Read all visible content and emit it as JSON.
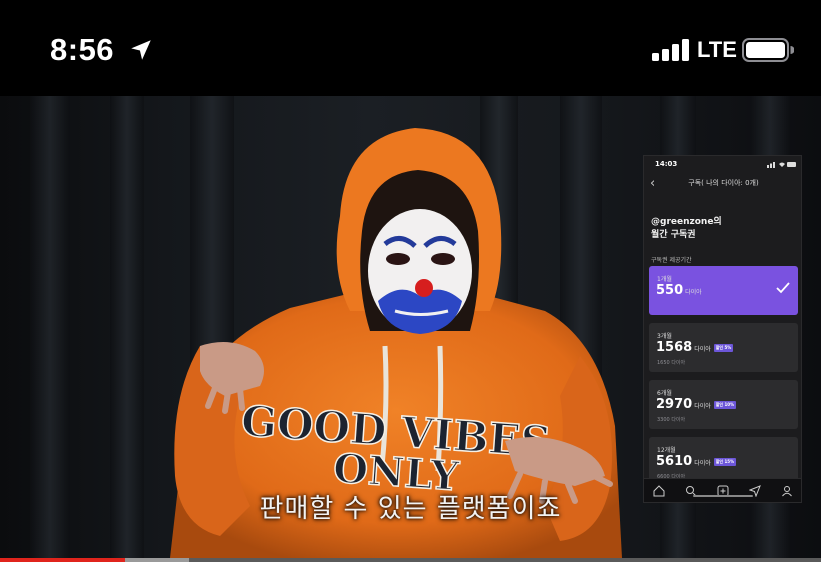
{
  "status_bar": {
    "time": "8:56",
    "network": "LTE",
    "icons": [
      "location-arrow-icon",
      "cellular-signal-icon",
      "battery-icon"
    ]
  },
  "video": {
    "subtitle": "판매할 수 있는 플랫폼이죠",
    "progress": {
      "played_fraction": 0.152,
      "buffered_fraction": 0.23
    }
  },
  "embedded_phone": {
    "time": "14:03",
    "header": "구독( 나의 다이아: 0개)",
    "channel_line1": "@greenzone의",
    "channel_line2": "월간 구독권",
    "section_label": "구독권 제공기간",
    "plans": [
      {
        "term": "1개월",
        "price": "550",
        "unit": "다이아",
        "badge": "",
        "sub": "",
        "selected": true
      },
      {
        "term": "3개월",
        "price": "1568",
        "unit": "다이아",
        "badge": "할인 5%",
        "sub": "1650 다이아",
        "selected": false
      },
      {
        "term": "6개월",
        "price": "2970",
        "unit": "다이아",
        "badge": "할인 10%",
        "sub": "3300 다이아",
        "selected": false
      },
      {
        "term": "12개월",
        "price": "5610",
        "unit": "다이아",
        "badge": "할인 15%",
        "sub": "6600 다이아",
        "selected": false
      }
    ],
    "tab_icons": [
      "home-icon",
      "search-icon",
      "add-icon",
      "send-icon",
      "profile-icon"
    ]
  },
  "colors": {
    "accent_purple": "#7a52e0",
    "progress_red": "#e0241c",
    "hoodie_orange": "#e8711c"
  }
}
